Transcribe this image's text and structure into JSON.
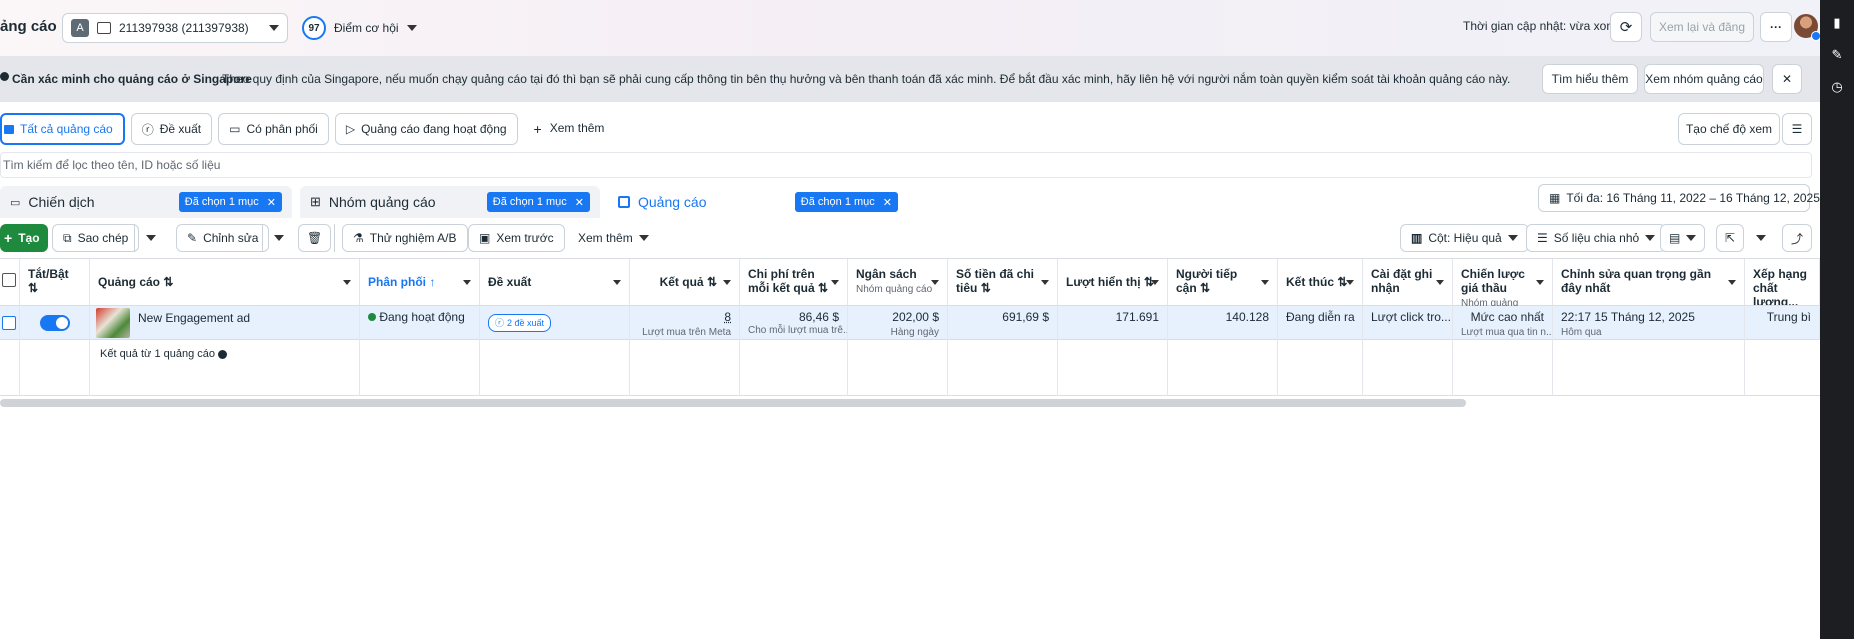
{
  "header": {
    "title": "ảng cáo",
    "account_badge": "A",
    "account_label": "211397938 (211397938)",
    "score_value": "97",
    "score_label": "Điểm cơ hội",
    "updated_text": "Thời gian cập nhật: vừa xong",
    "review_publish": "Xem lại và đăng",
    "more": "···"
  },
  "banner": {
    "title": "Cần xác minh cho quảng cáo ở Singapore",
    "text": "Theo quy định của Singapore, nếu muốn chạy quảng cáo tại đó thì bạn sẽ phải cung cấp thông tin bên thụ hưởng và bên thanh toán đã xác minh. Để bắt đầu xác minh, hãy liên hệ với người nắm toàn quyền kiểm soát tài khoản quảng cáo này.",
    "learn_more": "Tìm hiểu thêm",
    "view_adsets": "Xem nhóm quảng cáo",
    "close": "✕"
  },
  "filters": {
    "all_ads": "Tất cả quảng cáo",
    "recommendations": "Đề xuất",
    "delivering": "Có phân phối",
    "active_ads": "Quảng cáo đang hoạt động",
    "see_more": "Xem thêm",
    "create_view": "Tạo chế độ xem"
  },
  "search": {
    "placeholder": "Tìm kiếm để lọc theo tên, ID hoặc số liệu"
  },
  "levels": {
    "campaign": "Chiến dịch",
    "campaign_chip": "Đã chọn 1 mục",
    "adset": "Nhóm quảng cáo",
    "adset_chip": "Đã chọn 1 mục",
    "ad": "Quảng cáo",
    "ad_chip": "Đã chọn 1 mục",
    "date_range": "Tối đa: 16 Tháng 11, 2022 – 16 Tháng 12, 2025"
  },
  "toolbar": {
    "create": "Tạo",
    "duplicate": "Sao chép",
    "edit": "Chỉnh sửa",
    "ab_test": "Thử nghiệm A/B",
    "preview": "Xem trước",
    "more": "Xem thêm",
    "columns": "Cột: Hiệu quả",
    "breakdown": "Số liệu chia nhỏ"
  },
  "columns": {
    "toggle": "Tắt/Bật",
    "ad": "Quảng cáo",
    "delivery": "Phân phối",
    "recommendations": "Đề xuất",
    "results": "Kết quả",
    "cost_per_result": "Chi phí trên mỗi kết quả",
    "budget": "Ngân sách",
    "budget_sub": "Nhóm quảng cáo",
    "amount_spent": "Số tiền đã chi tiêu",
    "impressions": "Lượt hiển thị",
    "reach": "Người tiếp cận",
    "ends": "Kết thúc",
    "attribution": "Cài đặt ghi nhận",
    "bid_strategy": "Chiến lược giá thầu",
    "bid_strategy_sub": "Nhóm quảng cáo",
    "last_edit": "Chỉnh sửa quan trọng gần đây nhất",
    "quality": "Xếp hạng chất lượng..."
  },
  "row": {
    "ad_name": "New Engagement ad",
    "delivery": "Đang hoạt động",
    "recommendations": "2 đề xuất",
    "results": "8",
    "results_sub": "Lượt mua trên Meta",
    "cost_per_result": "86,46 $",
    "cost_per_result_sub": "Cho mỗi lượt mua trê...",
    "budget": "202,00 $",
    "budget_sub": "Hàng ngày",
    "amount_spent": "691,69 $",
    "impressions": "171.691",
    "reach": "140.128",
    "ends": "Đang diễn ra",
    "attribution": "Lượt click tro...",
    "bid_strategy": "Mức cao nhất",
    "bid_strategy_sub": "Lượt mua qua tin n...",
    "last_edit": "22:17 15 Tháng 12, 2025",
    "last_edit_sub": "Hôm qua",
    "quality": "Trung bì"
  },
  "totals": {
    "label": "Kết quả từ 1 quảng cáo"
  }
}
